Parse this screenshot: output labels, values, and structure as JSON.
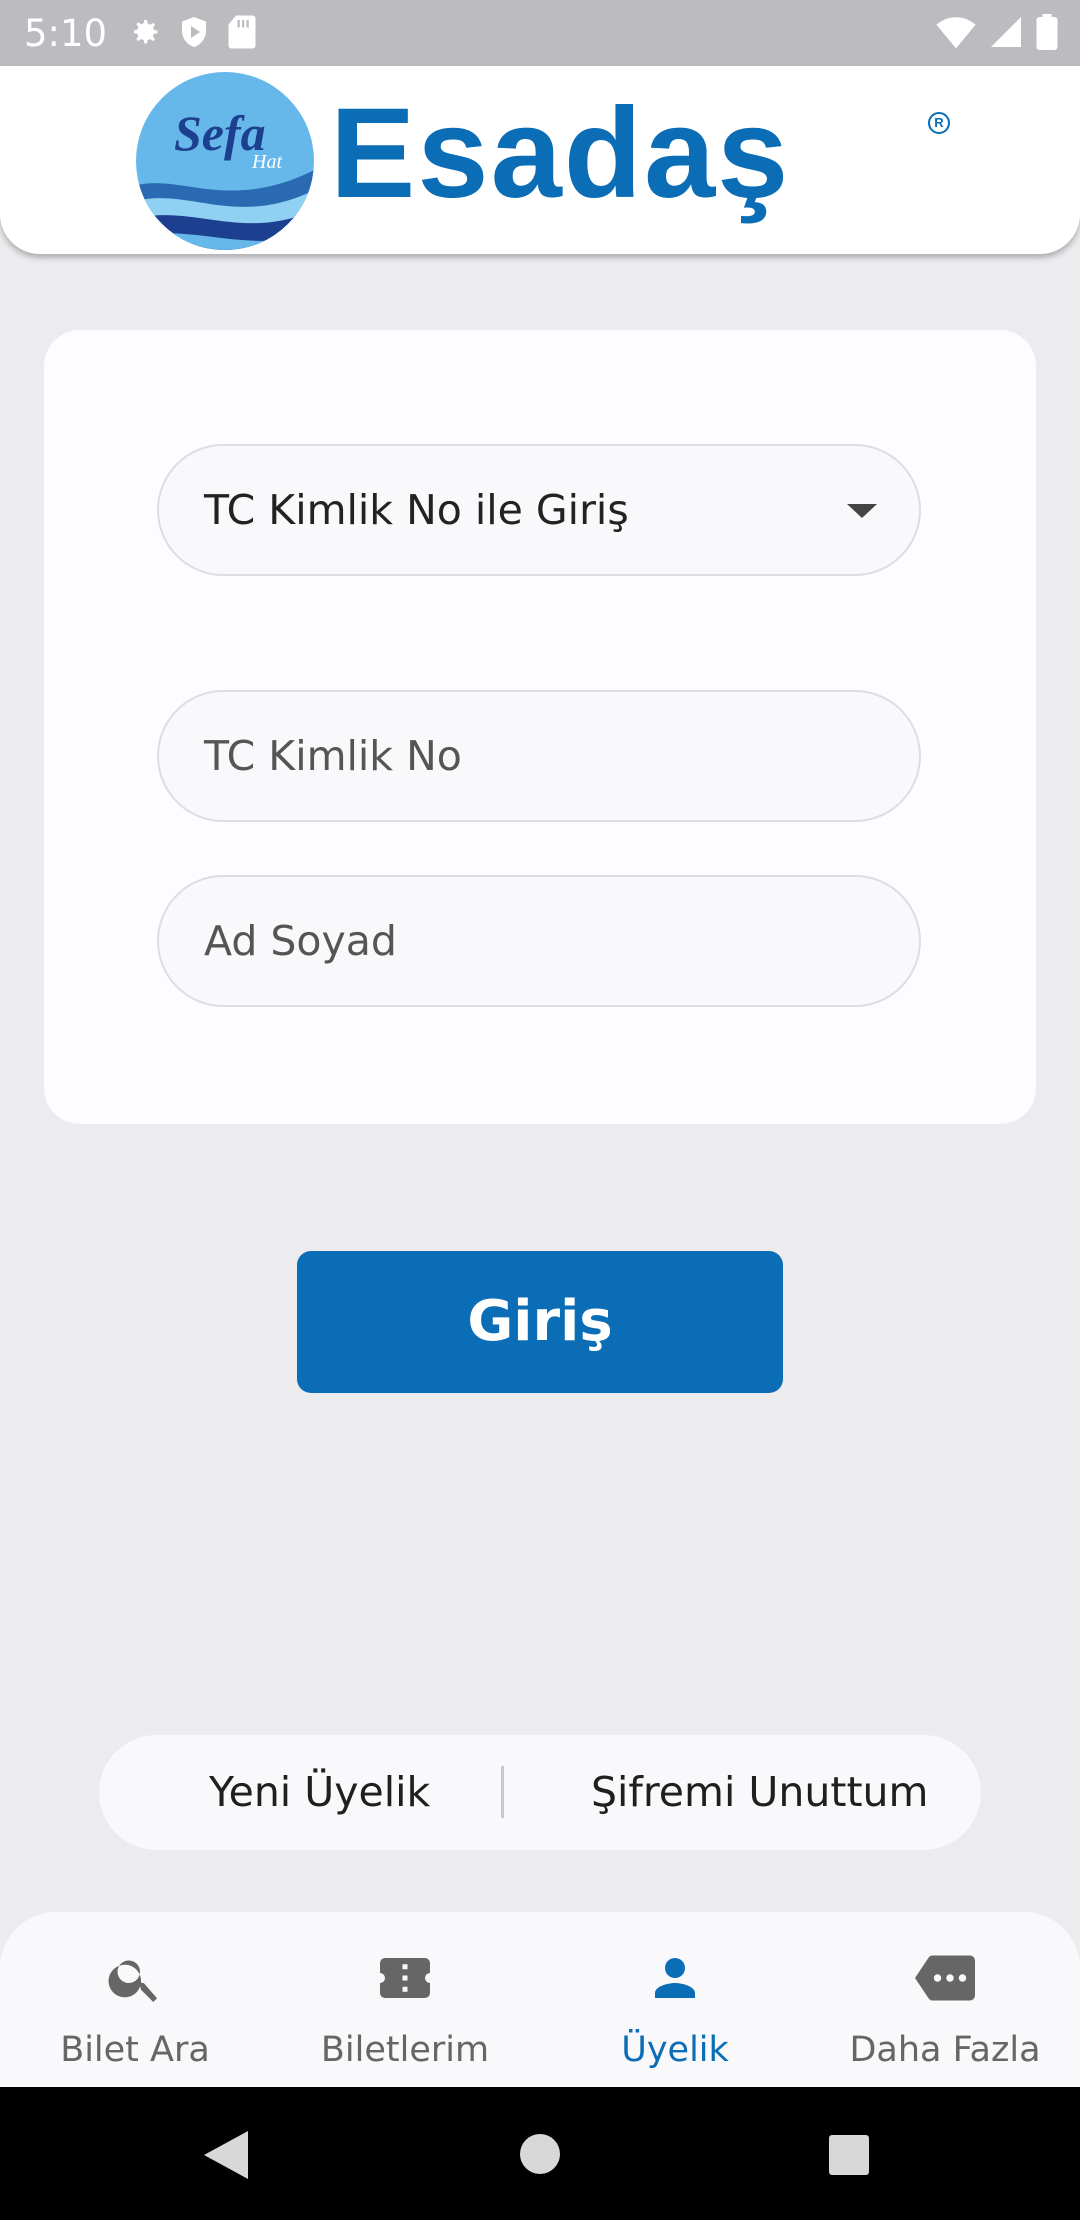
{
  "status_bar": {
    "time": "5:10"
  },
  "brand": {
    "name": "Esadaş",
    "badge_line1": "Sefa",
    "badge_line2": "Hat",
    "colors": {
      "primary": "#0a6db5",
      "light": "#5fb3e6"
    }
  },
  "form": {
    "login_type": {
      "selected": "TC Kimlik No ile Giriş",
      "icon": "chevron-down-icon"
    },
    "tc_no": {
      "value": "",
      "placeholder": "TC Kimlik No"
    },
    "full_name": {
      "value": "",
      "placeholder": "Ad Soyad"
    }
  },
  "login_button": {
    "label": "Giriş"
  },
  "links": {
    "new_member": "Yeni Üyelik",
    "forgot_password": "Şifremi Unuttum"
  },
  "bottom_nav": {
    "items": [
      {
        "label": "Bilet Ara",
        "icon": "search-icon",
        "active": false
      },
      {
        "label": "Biletlerim",
        "icon": "ticket-icon",
        "active": false
      },
      {
        "label": "Üyelik",
        "icon": "person-icon",
        "active": true
      },
      {
        "label": "Daha Fazla",
        "icon": "more-icon",
        "active": false
      }
    ]
  }
}
